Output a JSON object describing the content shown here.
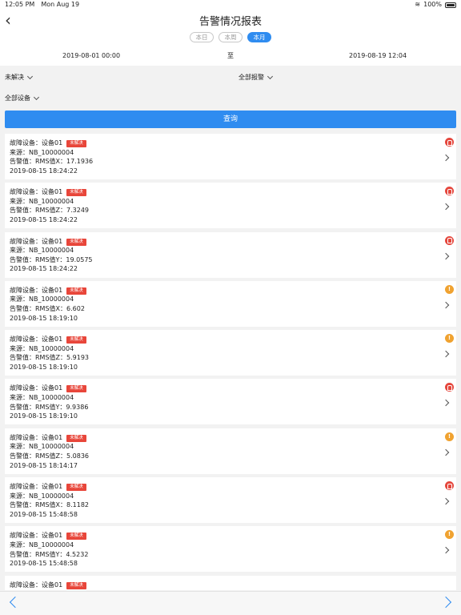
{
  "statusbar": {
    "time": "12:05 PM",
    "date": "Mon Aug 19",
    "battery": "100%"
  },
  "header": {
    "title": "告警情况报表",
    "back_icon": "chevron-left-icon"
  },
  "period_tabs": [
    {
      "label": "本日",
      "active": false
    },
    {
      "label": "本周",
      "active": false
    },
    {
      "label": "本月",
      "active": true
    }
  ],
  "date_range": {
    "start": "2019-08-01 00:00",
    "separator": "至",
    "end": "2019-08-19 12:04"
  },
  "filters": {
    "status": "未解决",
    "alarm_type": "全部报警",
    "device": "全部设备"
  },
  "query_button": "查询",
  "alarms": [
    {
      "device": "故障设备：设备01",
      "badge": "未解决",
      "source": "来源：NB_10000004",
      "value": "告警值：RMS值X：17.1936",
      "time": "2019-08-15 18:24:22",
      "level": "red"
    },
    {
      "device": "故障设备：设备01",
      "badge": "未解决",
      "source": "来源：NB_10000004",
      "value": "告警值：RMS值Z：7.3249",
      "time": "2019-08-15 18:24:22",
      "level": "red"
    },
    {
      "device": "故障设备：设备01",
      "badge": "未解决",
      "source": "来源：NB_10000004",
      "value": "告警值：RMS值Y：19.0575",
      "time": "2019-08-15 18:24:22",
      "level": "red"
    },
    {
      "device": "故障设备：设备01",
      "badge": "未解决",
      "source": "来源：NB_10000004",
      "value": "告警值：RMS值X：6.602",
      "time": "2019-08-15 18:19:10",
      "level": "orange"
    },
    {
      "device": "故障设备：设备01",
      "badge": "未解决",
      "source": "来源：NB_10000004",
      "value": "告警值：RMS值Z：5.9193",
      "time": "2019-08-15 18:19:10",
      "level": "orange"
    },
    {
      "device": "故障设备：设备01",
      "badge": "未解决",
      "source": "来源：NB_10000004",
      "value": "告警值：RMS值Y：9.9386",
      "time": "2019-08-15 18:19:10",
      "level": "red"
    },
    {
      "device": "故障设备：设备01",
      "badge": "未解决",
      "source": "来源：NB_10000004",
      "value": "告警值：RMS值Z：5.0836",
      "time": "2019-08-15 18:14:17",
      "level": "orange"
    },
    {
      "device": "故障设备：设备01",
      "badge": "未解决",
      "source": "来源：NB_10000004",
      "value": "告警值：RMS值X：8.1182",
      "time": "2019-08-15 15:48:58",
      "level": "red"
    },
    {
      "device": "故障设备：设备01",
      "badge": "未解决",
      "source": "来源：NB_10000004",
      "value": "告警值：RMS值Y：4.5232",
      "time": "2019-08-15 15:48:58",
      "level": "orange"
    },
    {
      "device": "故障设备：设备01",
      "badge": "未解决",
      "source": "",
      "value": "",
      "time": "",
      "level": ""
    }
  ],
  "colors": {
    "accent": "#2f8cf0",
    "badge": "#e8463a",
    "critical": "#e5473d",
    "warning": "#f0a230"
  }
}
